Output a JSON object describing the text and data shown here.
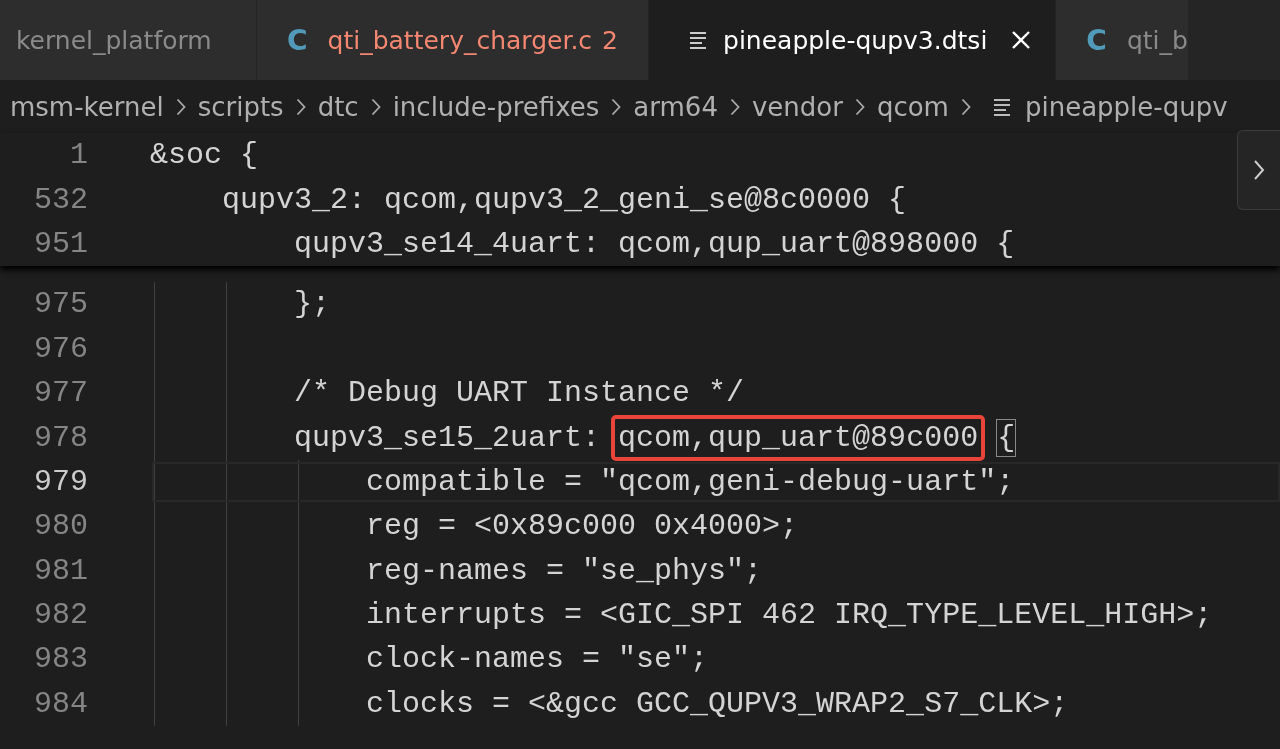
{
  "tabs": [
    {
      "label": "kernel_platform",
      "selected": false,
      "kind": "plain",
      "has_errors": false
    },
    {
      "label": "qti_battery_charger.c",
      "selected": false,
      "kind": "c",
      "icon_text": "C",
      "has_errors": true,
      "problems": "2"
    },
    {
      "label": "pineapple-qupv3.dtsi",
      "selected": true,
      "kind": "devicetree",
      "has_errors": false
    },
    {
      "label": "qti_b",
      "selected": false,
      "kind": "c",
      "icon_text": "C",
      "has_errors": false
    }
  ],
  "breadcrumbs": [
    {
      "label": "msm-kernel",
      "kind": "folder"
    },
    {
      "label": "scripts",
      "kind": "folder"
    },
    {
      "label": "dtc",
      "kind": "folder"
    },
    {
      "label": "include-prefixes",
      "kind": "folder"
    },
    {
      "label": "arm64",
      "kind": "folder"
    },
    {
      "label": "vendor",
      "kind": "folder"
    },
    {
      "label": "qcom",
      "kind": "folder"
    },
    {
      "label": "pineapple-qupv",
      "kind": "file"
    }
  ],
  "sticky_lines": [
    {
      "number": "1",
      "parts": [
        {
          "text": "&soc {"
        }
      ]
    },
    {
      "number": "532",
      "parts": [
        {
          "text": "    qupv3_2: qcom,qupv3_2_geni_se@8c0000 {"
        }
      ]
    },
    {
      "number": "951",
      "parts": [
        {
          "text": "        qupv3_se14_4uart: qcom,qup_uart@898000 {"
        }
      ]
    }
  ],
  "lines": [
    {
      "number": "975",
      "current": false,
      "parts": [
        {
          "text": "        };"
        }
      ]
    },
    {
      "number": "976",
      "current": false
    },
    {
      "number": "977",
      "current": false,
      "parts": [
        {
          "text": "        /* Debug UART Instance */"
        }
      ]
    },
    {
      "number": "978",
      "current": false,
      "parts": [
        {
          "text": "        qupv3_se15_2uart: "
        },
        {
          "text": "qcom,qup_uart@89c000",
          "annotated": true
        },
        {
          "text": "{",
          "bracket_match": true
        }
      ]
    },
    {
      "number": "979",
      "current": true,
      "parts": [
        {
          "text": "            compatible = \"qcom,geni-debug-uart\";"
        }
      ]
    },
    {
      "number": "980",
      "current": false,
      "parts": [
        {
          "text": "            reg = <0x89c000 0x4000>;"
        }
      ]
    },
    {
      "number": "981",
      "current": false,
      "parts": [
        {
          "text": "            reg-names = \"se_phys\";"
        }
      ]
    },
    {
      "number": "982",
      "current": false,
      "parts": [
        {
          "text": "            interrupts = <GIC_SPI 462 IRQ_TYPE_LEVEL_HIGH>;"
        }
      ]
    },
    {
      "number": "983",
      "current": false,
      "parts": [
        {
          "text": "            clock-names = \"se\";"
        }
      ]
    },
    {
      "number": "984",
      "current": false,
      "parts": [
        {
          "text": "            clocks = <&gcc GCC_QUPV3_WRAP2_S7_CLK>;"
        }
      ]
    }
  ]
}
